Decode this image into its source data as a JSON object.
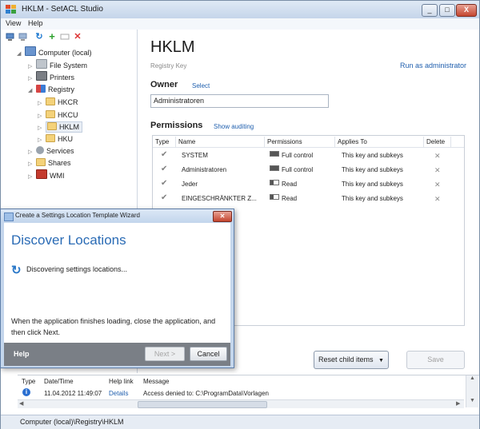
{
  "window": {
    "title": "HKLM - SetACL Studio"
  },
  "window_controls": {
    "minimize": "_",
    "maximize": "□",
    "close": "X"
  },
  "menu": [
    "View",
    "Help"
  ],
  "toolbar": {
    "icons": [
      "computer-add-icon",
      "computer-remove-icon",
      "refresh-icon",
      "add-icon",
      "rename-icon",
      "delete-icon"
    ]
  },
  "tree": {
    "computer": "Computer (local)",
    "file_system": "File System",
    "printers": "Printers",
    "registry": "Registry",
    "hkcr": "HKCR",
    "hkcu": "HKCU",
    "hklm": "HKLM",
    "hku": "HKU",
    "services": "Services",
    "shares": "Shares",
    "wmi": "WMI"
  },
  "detail": {
    "title": "HKLM",
    "subtitle": "Registry Key",
    "run_as_admin": "Run as administrator",
    "owner_label": "Owner",
    "owner_select": "Select",
    "owner_value": "Administratoren",
    "permissions_label": "Permissions",
    "show_auditing": "Show auditing"
  },
  "permissions_table": {
    "columns": [
      "Type",
      "Name",
      "Permissions",
      "Applies To",
      "Delete"
    ],
    "rows": [
      {
        "name": "SYSTEM",
        "permission": "Full control",
        "applies_to": "This key and subkeys"
      },
      {
        "name": "Administratoren",
        "permission": "Full control",
        "applies_to": "This key and subkeys"
      },
      {
        "name": "Jeder",
        "permission": "Read",
        "applies_to": "This key and subkeys"
      },
      {
        "name": "EINGESCHRÄNKTER Z...",
        "permission": "Read",
        "applies_to": "This key and subkeys"
      }
    ]
  },
  "buttons": {
    "reset_child_items": "Reset child items",
    "save": "Save"
  },
  "log": {
    "columns": [
      "Type",
      "Date/Time",
      "Help link",
      "Message"
    ],
    "rows": [
      {
        "datetime": "11.04.2012 11:49:07",
        "link": "Details",
        "message": "Access denied to: C:\\ProgramData\\Vorlagen"
      }
    ]
  },
  "status_bar": {
    "path": "Computer (local)\\Registry\\HKLM"
  },
  "wizard": {
    "title": "Create a Settings Location Template Wizard",
    "heading": "Discover Locations",
    "status": "Discovering settings locations...",
    "instructions": "When the application finishes loading, close the application, and then click Next.",
    "help": "Help",
    "next": "Next >",
    "cancel": "Cancel"
  }
}
